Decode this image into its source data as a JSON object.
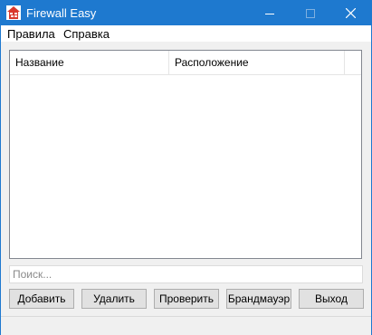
{
  "window": {
    "title": "Firewall Easy",
    "icon": "firewall-app-icon",
    "titlebar_color": "#1e79cf"
  },
  "window_controls": {
    "minimize_icon": "minimize-icon",
    "maximize_icon": "maximize-icon",
    "close_icon": "close-icon"
  },
  "menu": {
    "items": [
      {
        "label": "Правила"
      },
      {
        "label": "Справка"
      }
    ]
  },
  "list": {
    "columns": [
      {
        "label": "Название"
      },
      {
        "label": "Расположение"
      }
    ],
    "rows": []
  },
  "search": {
    "placeholder": "Поиск...",
    "value": ""
  },
  "buttons": {
    "add": "Добавить",
    "delete": "Удалить",
    "check": "Проверить",
    "firewall": "Брандмауэр",
    "exit": "Выход"
  }
}
